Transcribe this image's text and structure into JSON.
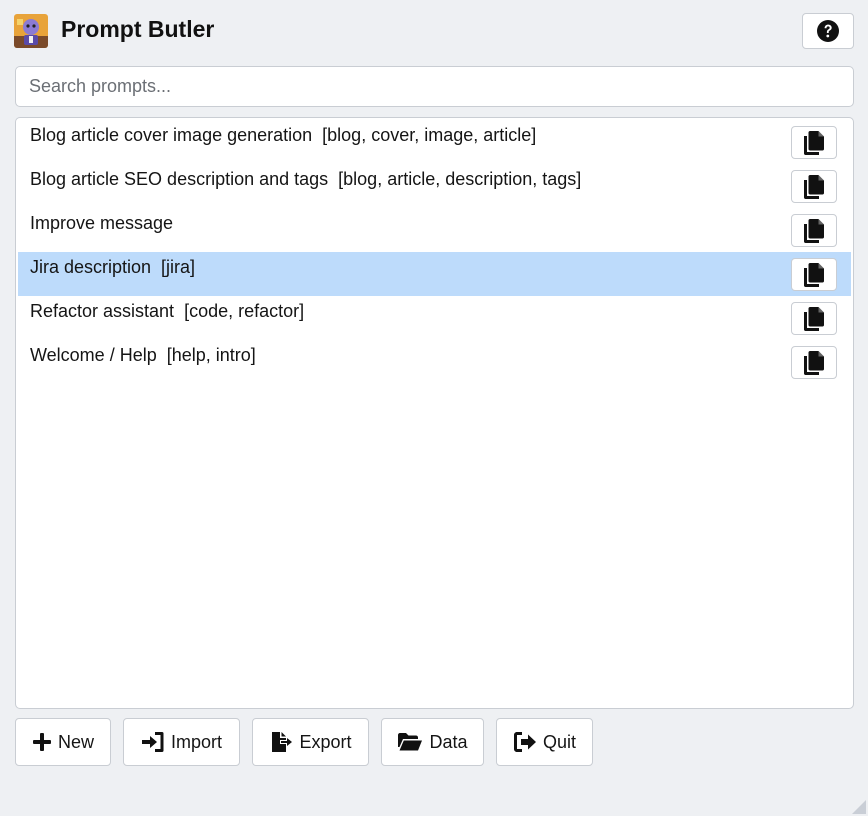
{
  "app": {
    "title": "Prompt Butler",
    "logo_icon": "butler-logo-icon",
    "help_icon": "question-circle-icon"
  },
  "search": {
    "placeholder": "Search prompts...",
    "value": ""
  },
  "prompts": [
    {
      "label": "Blog article cover image generation  [blog, cover, image, article]",
      "selected": false
    },
    {
      "label": "Blog article SEO description and tags  [blog, article, description, tags]",
      "selected": false
    },
    {
      "label": "Improve message",
      "selected": false
    },
    {
      "label": "Jira description  [jira]",
      "selected": true
    },
    {
      "label": "Refactor assistant  [code, refactor]",
      "selected": false
    },
    {
      "label": "Welcome / Help  [help, intro]",
      "selected": false
    }
  ],
  "toolbar": {
    "new_label": "New",
    "import_label": "Import",
    "export_label": "Export",
    "data_label": "Data",
    "quit_label": "Quit"
  },
  "colors": {
    "selected_row": "#bddbfb",
    "background": "#eef0f3",
    "border": "#c9cdd3",
    "icon": "#111111"
  }
}
